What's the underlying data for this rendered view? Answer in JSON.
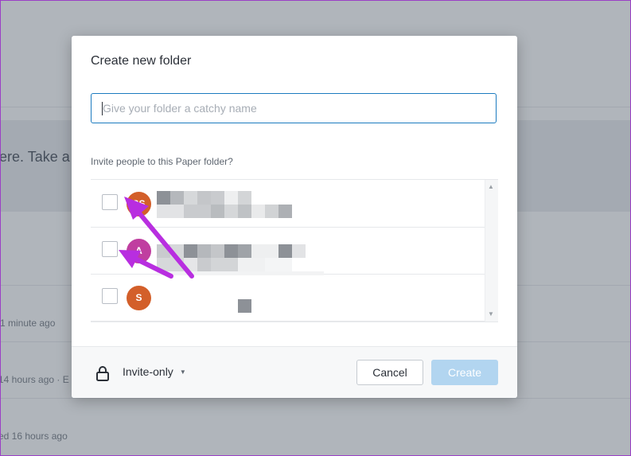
{
  "background": {
    "banner_text": "ere. Take a",
    "timestamps": [
      "1 minute ago",
      "14 hours ago · E",
      "ed 16 hours ago"
    ]
  },
  "modal": {
    "title": "Create new folder",
    "name_input": {
      "value": "",
      "placeholder": "Give your folder a catchy name"
    },
    "invite_label": "Invite people to this Paper folder?",
    "people": [
      {
        "initials": "SS",
        "avatar_color": "#d35f2a",
        "checked": false
      },
      {
        "initials": "A",
        "avatar_color": "#c03ea0",
        "checked": false
      },
      {
        "initials": "S",
        "avatar_color": "#d35f2a",
        "checked": false
      }
    ],
    "footer": {
      "lock_icon": "lock-icon",
      "access_label": "Invite-only",
      "cancel_label": "Cancel",
      "create_label": "Create"
    }
  },
  "colors": {
    "accent": "#1c7bbf",
    "create_disabled": "#b2d5f0",
    "annotation_arrow": "#b82ee0"
  }
}
